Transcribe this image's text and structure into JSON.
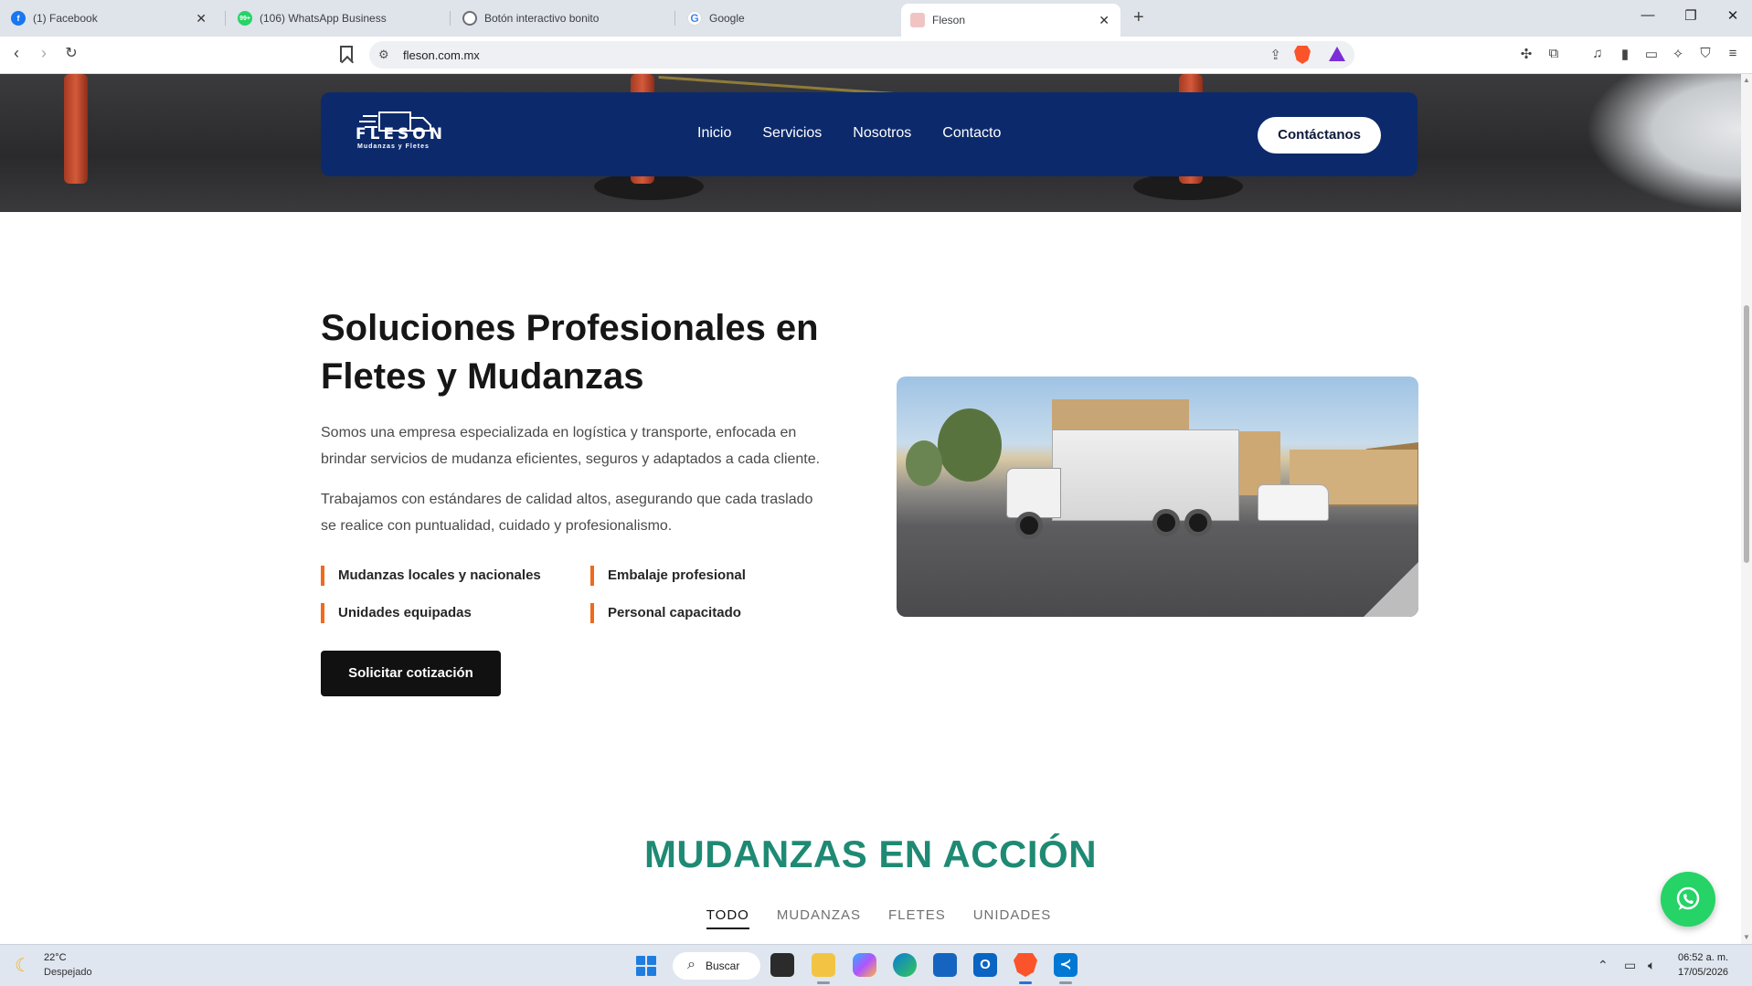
{
  "browser": {
    "tabs": [
      {
        "title": "(1) Facebook",
        "favicon": "facebook-icon",
        "color": "#1877f2",
        "active": false
      },
      {
        "title": "(106) WhatsApp Business",
        "favicon": "whatsapp-business-icon",
        "badge": "99+",
        "color": "#25d366",
        "active": false
      },
      {
        "title": "Botón interactivo bonito",
        "favicon": "globe-icon",
        "color": "#6b6f76",
        "active": false
      },
      {
        "title": "Google",
        "favicon": "google-icon",
        "color": "#4285f4",
        "active": false
      },
      {
        "title": "Fleson",
        "favicon": "fleson-icon",
        "color": "#e8a0a0",
        "active": true
      }
    ],
    "url": "fleson.com.mx"
  },
  "nav": {
    "logo_text": "FLESON",
    "logo_sub": "Mudanzas y Fletes",
    "links": [
      "Inicio",
      "Servicios",
      "Nosotros",
      "Contacto"
    ],
    "cta": "Contáctanos"
  },
  "about": {
    "title_line1": "Soluciones Profesionales en",
    "title_line2": "Fletes y Mudanzas",
    "p1_line1": "Somos una empresa especializada en logística y transporte, enfocada en",
    "p1_line2": "brindar servicios de mudanza eficientes, seguros y adaptados a cada cliente.",
    "p2_line1": "Trabajamos con estándares de calidad altos, asegurando que cada traslado",
    "p2_line2": "se realice con puntualidad, cuidado y profesionalismo.",
    "features": [
      "Mudanzas locales y nacionales",
      "Embalaje profesional",
      "Unidades equipadas",
      "Personal capacitado"
    ],
    "cta": "Solicitar cotización",
    "accent": "#ef6a1c"
  },
  "gallery": {
    "title": "MUDANZAS EN ACCIÓN",
    "title_color": "#1f8a74",
    "filters": [
      "TODO",
      "MUDANZAS",
      "FLETES",
      "UNIDADES"
    ],
    "active_filter": "TODO"
  },
  "taskbar": {
    "weather_temp": "22°C",
    "weather_desc": "Despejado",
    "search_label": "Buscar",
    "time": "06:52 a. m.",
    "date": "17/05/2026"
  }
}
